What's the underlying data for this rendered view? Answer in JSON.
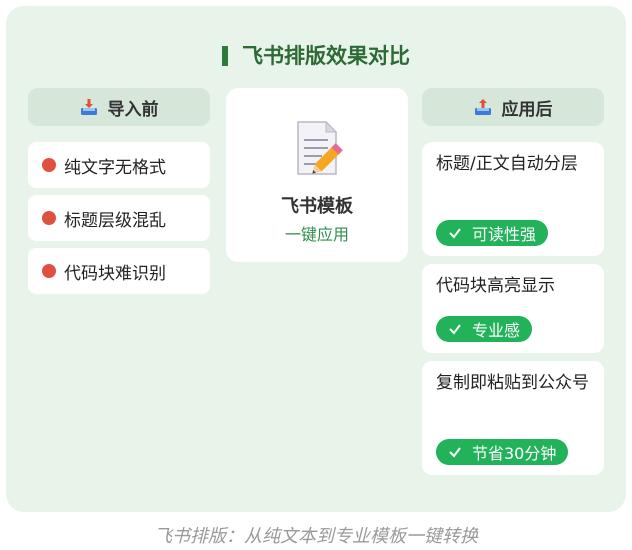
{
  "title": "飞书排版效果对比",
  "before": {
    "header": "导入前",
    "icon": "inbox-tray-icon",
    "items": [
      "纯文字无格式",
      "标题层级混乱",
      "代码块难识别"
    ]
  },
  "center": {
    "icon": "memo-pencil-icon",
    "title": "飞书模板",
    "subtitle": "一键应用"
  },
  "after": {
    "header": "应用后",
    "icon": "outbox-tray-icon",
    "items": [
      {
        "text": "标题/正文自动分层",
        "badge": "可读性强"
      },
      {
        "text": "代码块高亮显示",
        "badge": "专业感"
      },
      {
        "text": "复制即粘贴到公众号",
        "badge": "节省30分钟"
      }
    ]
  },
  "caption": "飞书排版：从纯文本到专业模板一键转换",
  "colors": {
    "background": "#e8f3e9",
    "header": "#d6e6d9",
    "accent_green": "#22b35a",
    "title_green": "#2d6a36",
    "dot_red": "#e0503f"
  }
}
